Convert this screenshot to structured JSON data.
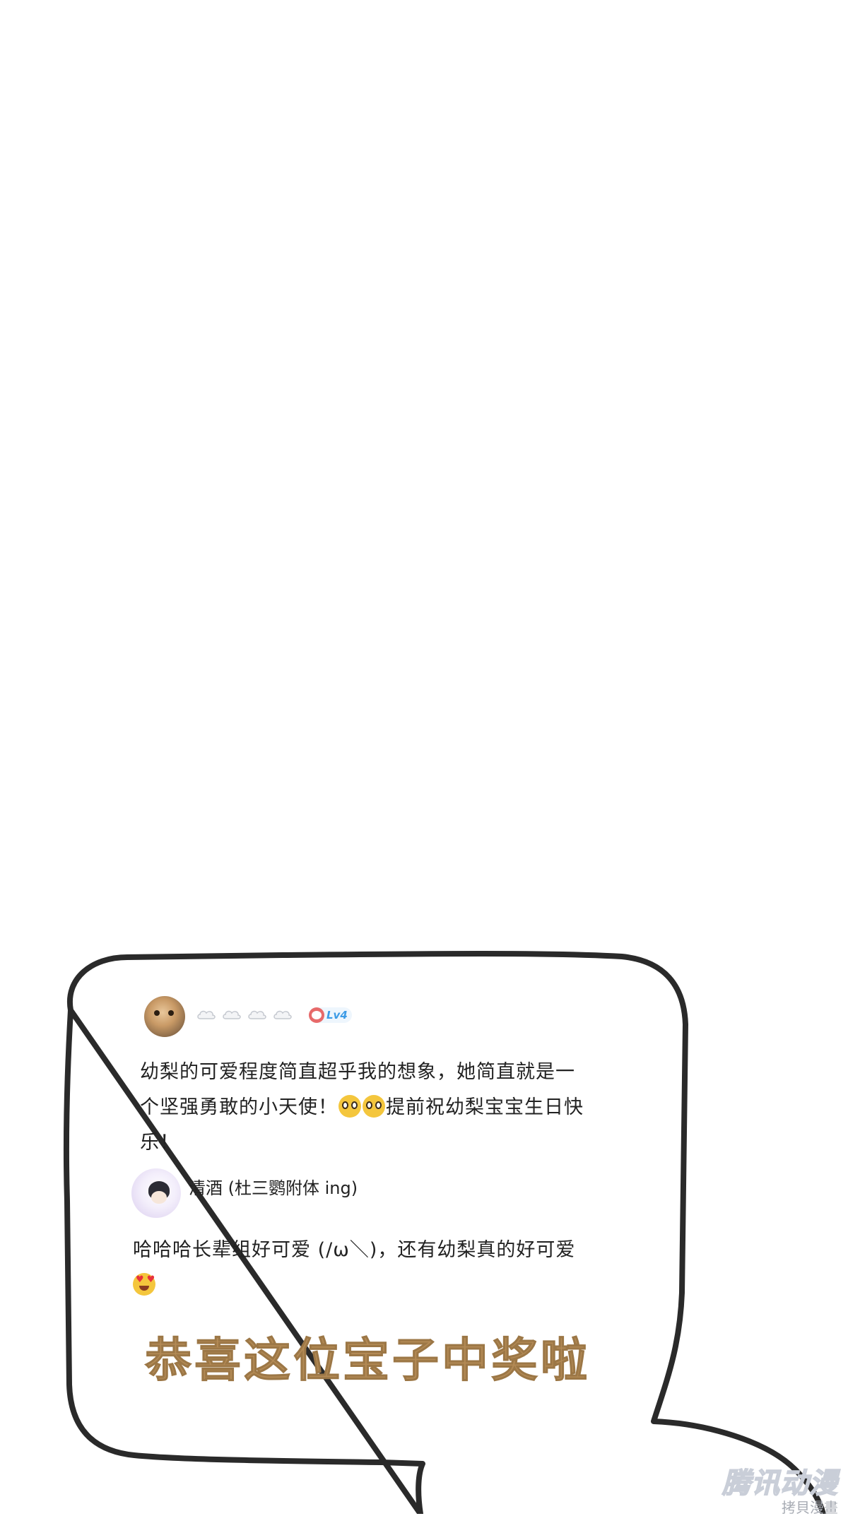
{
  "comment_1": {
    "avatar": "cat-avatar",
    "badge_icons": [
      "cloud-icon",
      "cloud-icon",
      "cloud-icon",
      "cloud-icon"
    ],
    "level": "Lv4",
    "text_before_emoji": "幼梨的可爱程度简直超乎我的想象，她简直就是一个坚强勇敢的小天使！",
    "emoji": "pleading-face-icon",
    "text_after_emoji": "提前祝幼梨宝宝生日快乐！"
  },
  "comment_2": {
    "avatar": "anime-avatar",
    "username": "清酒 (杜三鹦附体 ing)",
    "text": "哈哈哈长辈组好可爱 (/ω＼)，还有幼梨真的好可爱",
    "emoji": "heart-eyes-icon"
  },
  "headline": "恭喜这位宝子中奖啦",
  "watermark": {
    "logo": "腾讯动漫",
    "sub": "拷貝漫畫"
  },
  "colors": {
    "bubble_stroke": "#2a2a2a",
    "headline": "#b38a55",
    "level_text": "#3c9be6"
  }
}
